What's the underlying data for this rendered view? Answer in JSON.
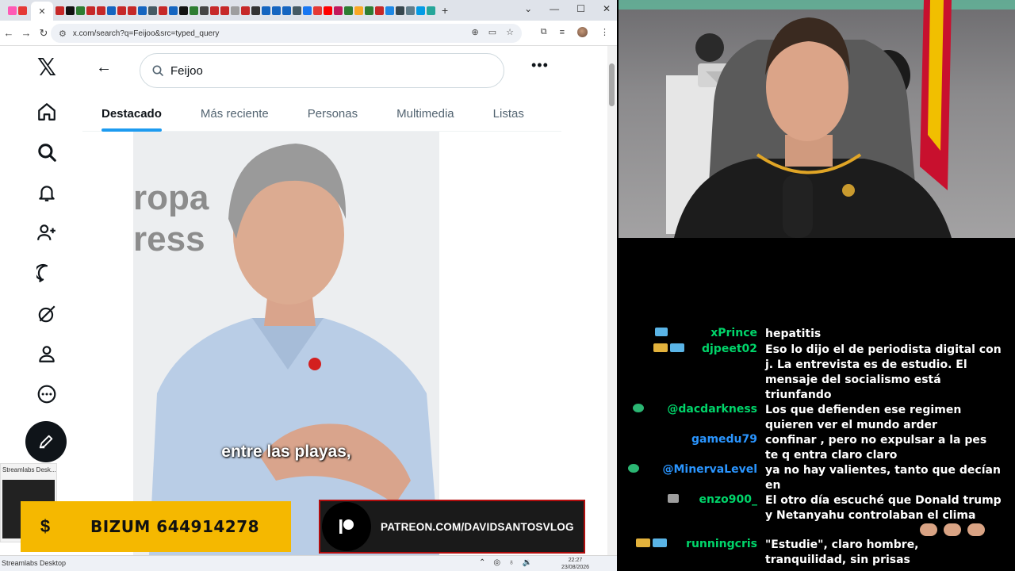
{
  "browser": {
    "url": "x.com/search?q=Feijoo&src=typed_query",
    "new_tab_glyph": "+"
  },
  "x": {
    "search_query": "Feijoo",
    "tabs": [
      {
        "label": "Destacado",
        "active": true
      },
      {
        "label": "Más reciente",
        "active": false
      },
      {
        "label": "Personas",
        "active": false
      },
      {
        "label": "Multimedia",
        "active": false
      },
      {
        "label": "Listas",
        "active": false
      }
    ],
    "video": {
      "wall_line1": "ropa",
      "wall_line2": "ress",
      "caption": "entre las playas,"
    }
  },
  "taskbar_preview": {
    "title": "Streamlabs Desk..."
  },
  "overlays": {
    "bizum": {
      "icon": "$",
      "text": "BIZUM 644914278"
    },
    "patreon": {
      "text": "PATREON.COM/DAVIDSANTOSVLOG"
    }
  },
  "taskbar": {
    "app": "Streamlabs Desktop",
    "time": "22:27",
    "date": "23/08/2026"
  },
  "chat": {
    "messages": [
      {
        "user": "xPrince",
        "text": "hepatitis",
        "color": "green"
      },
      {
        "user": "djpeet02",
        "text": "Eso lo dijo el de periodista digital con j. La entrevista es de estudio. El mensaje del socialismo está triunfando",
        "color": "green"
      },
      {
        "user": "@dacdarkness",
        "text": "Los que defienden ese regimen quieren ver el mundo arder",
        "color": "green"
      },
      {
        "user": "gamedu79",
        "text": "confinar , pero no expulsar a la pes te q entra claro claro",
        "color": "blue"
      },
      {
        "user": "@MinervaLevel",
        "text": "ya no hay valientes, tanto que decían en",
        "color": "blue"
      },
      {
        "user": "enzo900_",
        "text": "El otro día escuché que Donald trump y Netanyahu controlaban el clima",
        "color": "green"
      },
      {
        "user": "runningcris",
        "text": "\"Estudie\", claro hombre, tranquilidad, sin prisas",
        "color": "green"
      }
    ]
  }
}
